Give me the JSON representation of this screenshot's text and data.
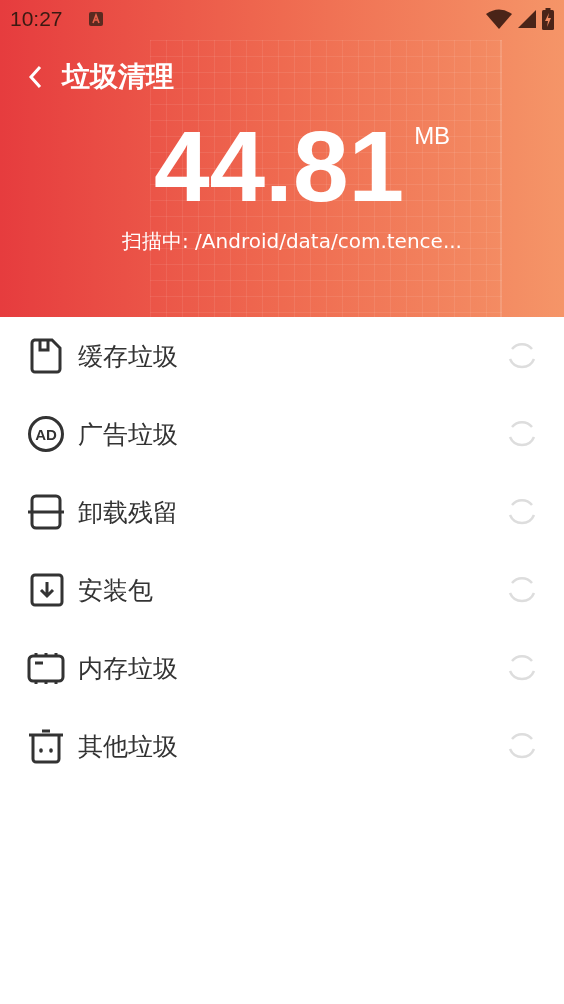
{
  "status_bar": {
    "time": "10:27"
  },
  "header": {
    "title": "垃圾清理",
    "size": "44.81",
    "unit": "MB",
    "scan_label": "扫描中: /Android/data/com.tence..."
  },
  "items": [
    {
      "kind": "cache",
      "label": "缓存垃圾"
    },
    {
      "kind": "ad",
      "label": "广告垃圾",
      "icon_label": "AD"
    },
    {
      "kind": "residue",
      "label": "卸载残留"
    },
    {
      "kind": "apk",
      "label": "安装包"
    },
    {
      "kind": "memory",
      "label": "内存垃圾"
    },
    {
      "kind": "other",
      "label": "其他垃圾"
    }
  ]
}
